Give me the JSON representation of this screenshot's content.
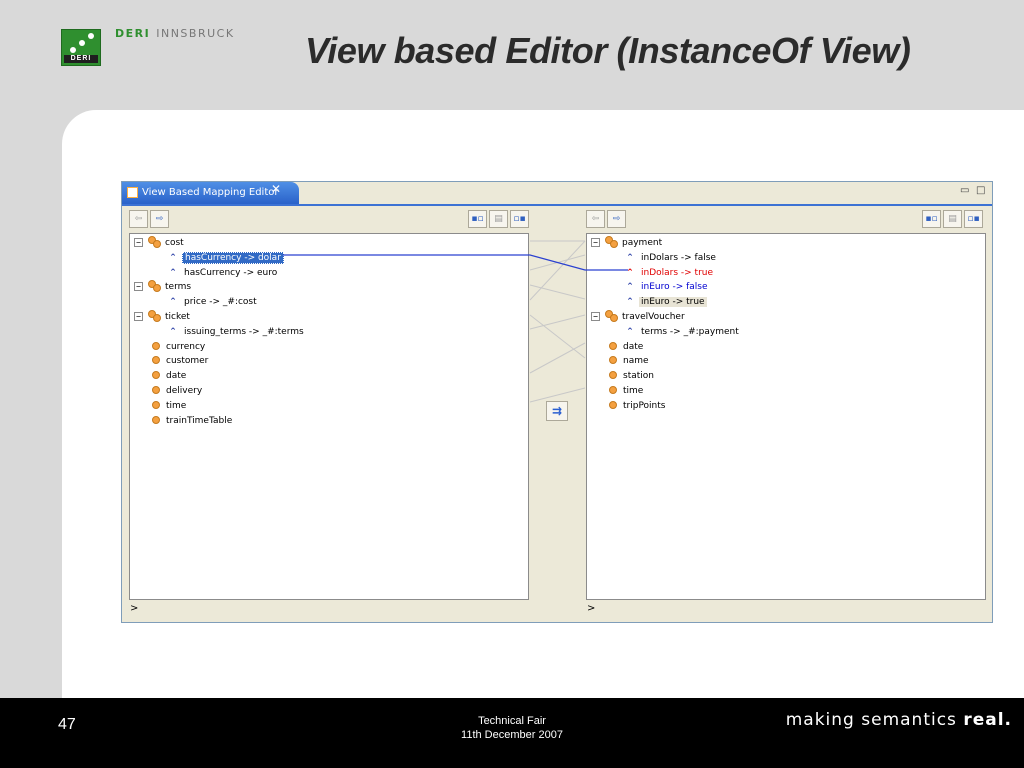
{
  "header": {
    "org_primary": "DERI",
    "org_secondary": "INNSBRUCK",
    "logo_text": "DERI",
    "slide_title": "View based Editor (InstanceOf View)"
  },
  "editor": {
    "tab_title": "View Based Mapping Editor",
    "close_glyph": "✕",
    "minimize_glyph": "▭",
    "maximize_glyph": "□",
    "toolbar": {
      "back_glyph": "⇦",
      "forward_glyph": "⇨",
      "btn1": "▪▫",
      "btn2": "▤",
      "btn3": "▫▪"
    },
    "map_button_glyph": "⇉",
    "left_status": ">",
    "right_status": ">",
    "left_tree": [
      {
        "label": "cost",
        "kind": "concept-expanded"
      },
      {
        "label": "hasCurrency -> dolar",
        "kind": "attribute",
        "state": "selected"
      },
      {
        "label": "hasCurrency -> euro",
        "kind": "attribute"
      },
      {
        "label": "terms",
        "kind": "concept-expanded"
      },
      {
        "label": "price -> _#:cost",
        "kind": "attribute"
      },
      {
        "label": "ticket",
        "kind": "concept-expanded"
      },
      {
        "label": "issuing_terms -> _#:terms",
        "kind": "attribute"
      },
      {
        "label": "currency",
        "kind": "concept"
      },
      {
        "label": "customer",
        "kind": "concept"
      },
      {
        "label": "date",
        "kind": "concept"
      },
      {
        "label": "delivery",
        "kind": "concept"
      },
      {
        "label": "time",
        "kind": "concept"
      },
      {
        "label": "trainTimeTable",
        "kind": "concept"
      }
    ],
    "right_tree": [
      {
        "label": "payment",
        "kind": "concept-expanded"
      },
      {
        "label": "inDolars -> false",
        "kind": "attribute"
      },
      {
        "label": "inDolars -> true",
        "kind": "attribute",
        "state": "red"
      },
      {
        "label": "inEuro -> false",
        "kind": "attribute",
        "state": "blue"
      },
      {
        "label": "inEuro -> true",
        "kind": "attribute",
        "state": "highlighted"
      },
      {
        "label": "travelVoucher",
        "kind": "concept-expanded"
      },
      {
        "label": "terms -> _#:payment",
        "kind": "attribute"
      },
      {
        "label": "date",
        "kind": "concept"
      },
      {
        "label": "name",
        "kind": "concept"
      },
      {
        "label": "station",
        "kind": "concept"
      },
      {
        "label": "time",
        "kind": "concept"
      },
      {
        "label": "tripPoints",
        "kind": "concept"
      }
    ]
  },
  "footer": {
    "page_number": "47",
    "event_name": "Technical Fair",
    "event_date": "11th December 2007",
    "slogan_prefix": "making semantics",
    "slogan_emphasis": "real."
  },
  "colors": {
    "brand_green": "#2f8f2f",
    "selection": "#316ac5",
    "tab_blue": "#2a62c9",
    "mapping_line": "#2a40d0"
  }
}
